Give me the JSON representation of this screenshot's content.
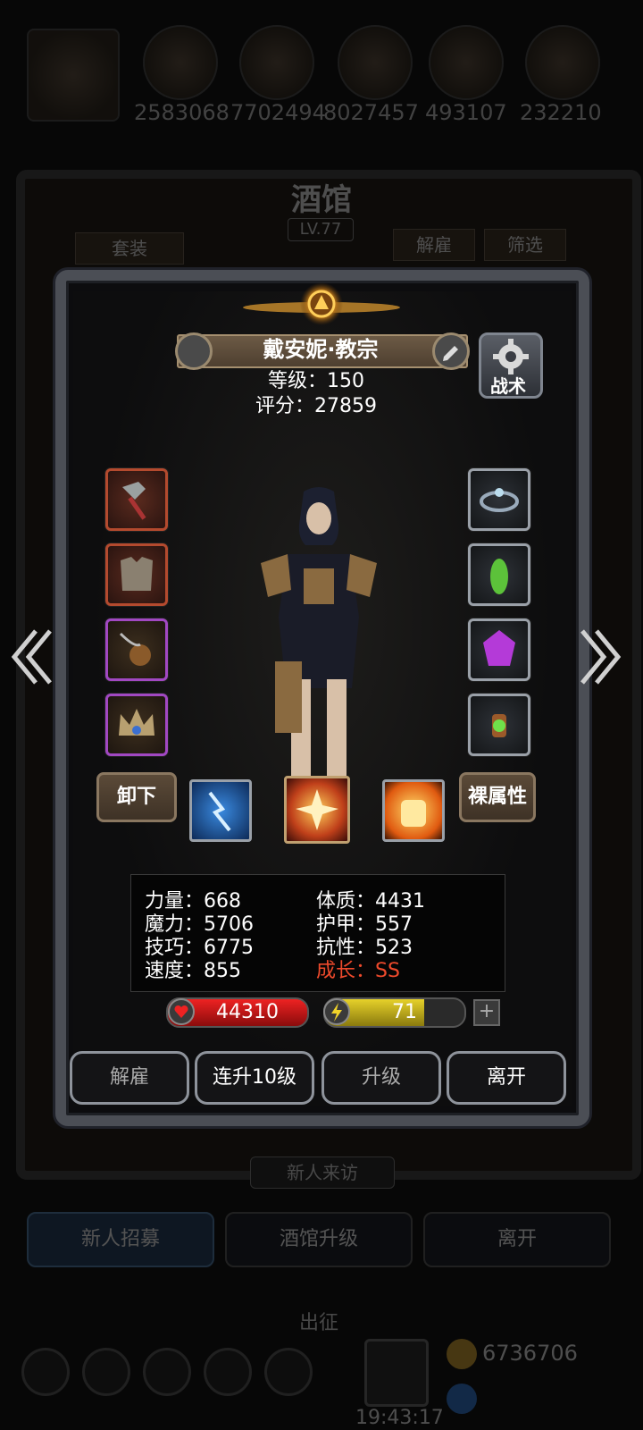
{
  "background": {
    "resources": [
      "2583068",
      "7702494",
      "8027457",
      "493107",
      "232210"
    ],
    "tavern_title": "酒馆",
    "tavern_level": "LV.77",
    "set_button": "套装",
    "dismiss_button": "解雇",
    "filter_button": "筛选",
    "new_visitor": "新人来访",
    "recruit_button": "新人招募",
    "tavern_upgrade_button": "酒馆升级",
    "leave_button": "离开",
    "expedition": "出征",
    "gold": "6736706",
    "time": "19:43:17"
  },
  "hero": {
    "name": "戴安妮·教宗",
    "level_line": "等级：150",
    "score_line": "评分：27859",
    "tactics_label": "战术",
    "unequip_label": "卸下",
    "base_attr_label": "裸属性"
  },
  "stats": {
    "strength": "力量：668",
    "magic": "魔力：5706",
    "skill": "技巧：6775",
    "speed": "速度：855",
    "constitution": "体质：4431",
    "armor": "护甲：557",
    "resistance": "抗性：523",
    "growth_label": "成长：",
    "growth_value": "SS"
  },
  "bars": {
    "hp": "44310",
    "energy": "71",
    "energy_fraction": 0.71,
    "plus": "+"
  },
  "actions": {
    "dismiss": "解雇",
    "level_up_10": "连升10级",
    "level_up": "升级",
    "leave": "离开"
  },
  "colors": {
    "growth": "#ee4a2c",
    "hp": "#e22222",
    "energy": "#e6d12a"
  }
}
